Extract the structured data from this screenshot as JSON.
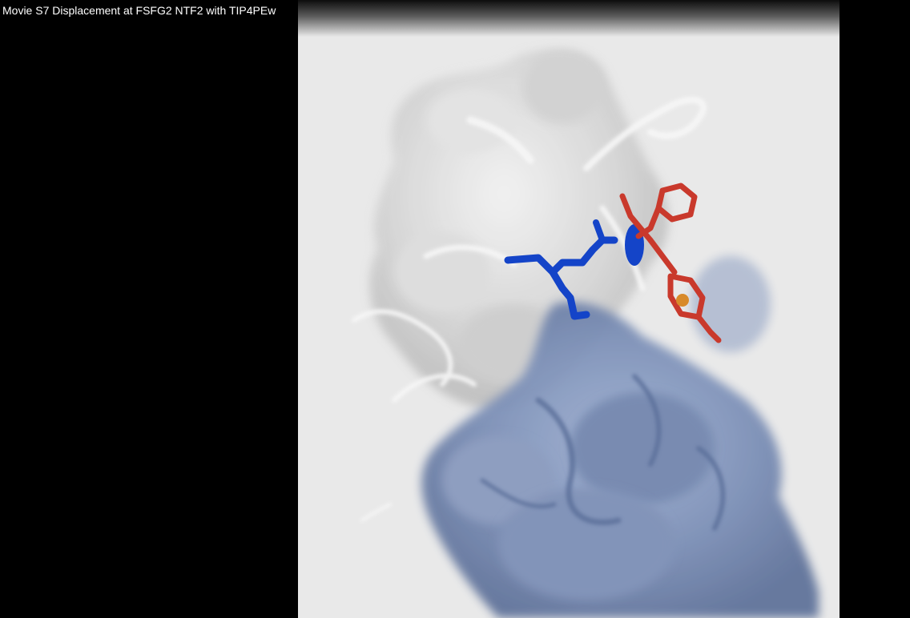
{
  "video": {
    "title": "Movie S7 Displacement at FSFG2 NTF2 with TIP4PEw"
  },
  "colors": {
    "background": "#000000",
    "frame_background": "#e9e9e9",
    "title_text": "#ffffff",
    "protein_white_surface": "#d9d9d9",
    "protein_blue_surface": "#7f92b8",
    "peptide_blue": "#1444c8",
    "peptide_red": "#c9392c"
  }
}
